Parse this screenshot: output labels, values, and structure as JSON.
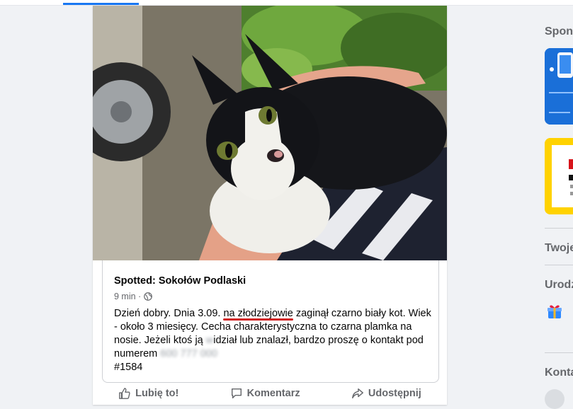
{
  "post": {
    "group_name": "Spotted: Sokołów Podlaski",
    "time": "9 min ·",
    "text_before": "Dzień dobry. Dnia 3.09.",
    "text_underlined": "na złodziejowie",
    "text_after": "zaginął czarno biały kot. Wiek - około 3 miesięcy. Cecha charakterystyczna to czarna plamka na nosie. Jeżeli ktoś ją",
    "text_redacted_1": "w",
    "text_after_2": "idział lub znalazł, bardzo proszę o kontakt pod numerem",
    "text_redacted_2": "600 777 000",
    "hashtag": "#1584",
    "photo_alt_icon": "kitten-photo"
  },
  "actions": {
    "like": "Lubię to!",
    "comment": "Komentarz",
    "share": "Udostępnij"
  },
  "sidebar": {
    "sponsored": "Spon",
    "your_pages": "Twoje",
    "birthdays": "Urodz",
    "contacts": "Konta"
  },
  "colors": {
    "accent": "#1877f2",
    "underline": "#d0201f"
  }
}
